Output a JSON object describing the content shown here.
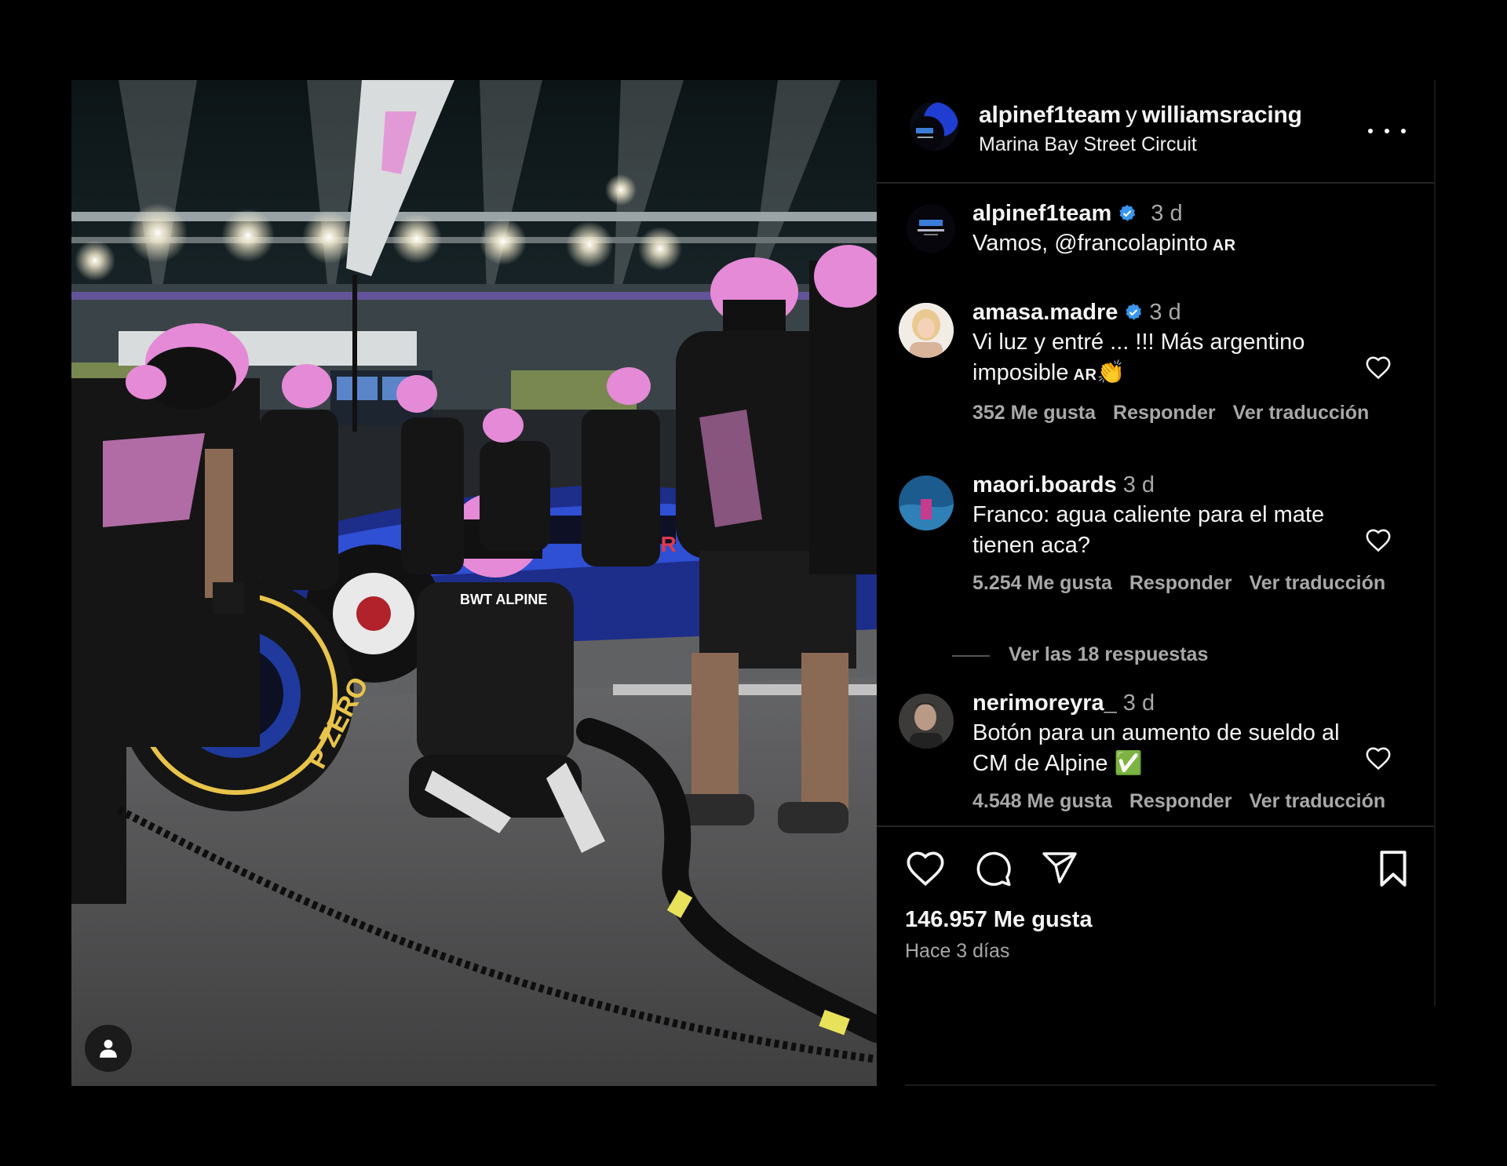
{
  "header": {
    "user1": "alpinef1team",
    "conj": "y",
    "user2": "williamsracing",
    "location": "Marina Bay Street Circuit"
  },
  "caption": {
    "user": "alpinef1team",
    "time": "3 d",
    "text": "Vamos, @francolapinto",
    "flag": "AR"
  },
  "comments": [
    {
      "user": "amasa.madre",
      "verified": true,
      "time": "3 d",
      "text_line1": "Vi luz y entré ... !!! Más argentino",
      "text_line2": "imposible",
      "flag": "AR",
      "emoji": "👏",
      "likes": "352 Me gusta",
      "reply": "Responder",
      "translate": "Ver traducción"
    },
    {
      "user": "maori.boards",
      "verified": false,
      "time": "3 d",
      "text_line1": "Franco: agua caliente para el mate",
      "text_line2": "tienen aca?",
      "likes": "5.254 Me gusta",
      "reply": "Responder",
      "translate": "Ver traducción",
      "view_replies": "Ver las 18 respuestas"
    },
    {
      "user": "nerimoreyra_",
      "verified": false,
      "time": "3 d",
      "text_line1": "Botón para un aumento de sueldo al",
      "text_line2": "CM de Alpine",
      "emoji": "✅",
      "likes": "4.548 Me gusta",
      "reply": "Responder",
      "translate": "Ver traducción"
    }
  ],
  "actions": {
    "icons": [
      "heart-icon",
      "comment-icon",
      "share-icon",
      "bookmark-icon"
    ],
    "likes": "146.957 Me gusta",
    "posted": "Hace 3 días"
  },
  "colors": {
    "background": "#000000",
    "text": "#f5f5f5",
    "secondary_text": "#a8a8a8",
    "verified": "#3897f0",
    "team_pink": "#e58ad6",
    "team_blue": "#1b3fb8"
  }
}
